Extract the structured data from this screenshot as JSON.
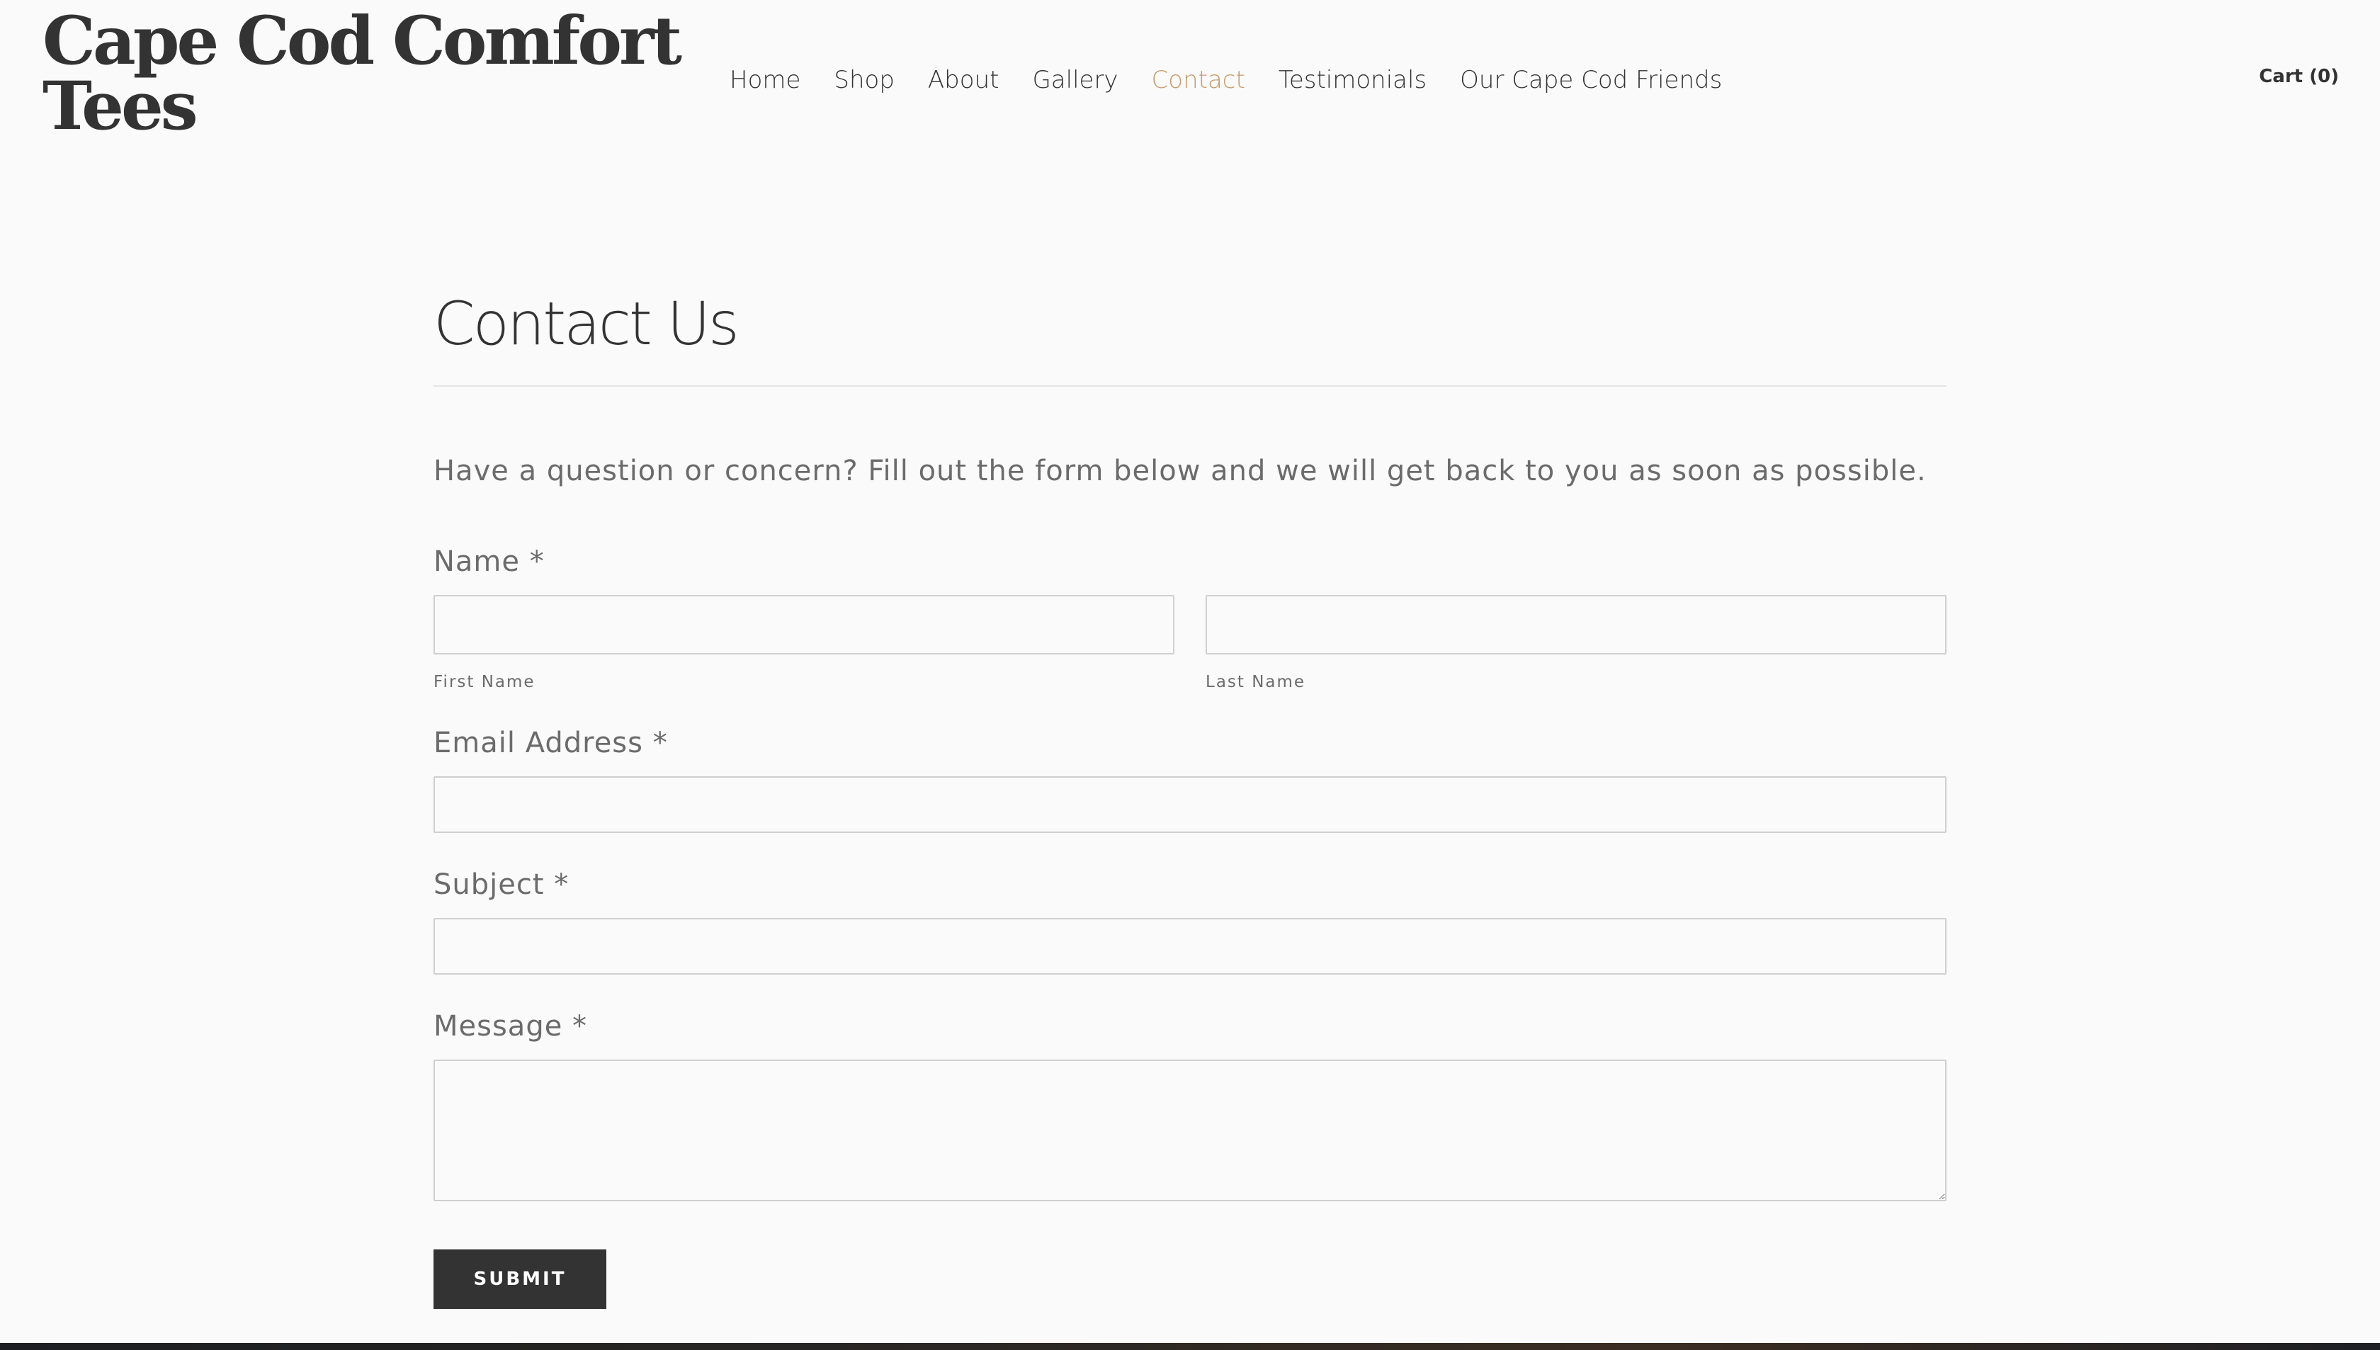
{
  "header": {
    "site_title": "Cape Cod Comfort Tees",
    "nav": [
      {
        "label": "Home",
        "active": false
      },
      {
        "label": "Shop",
        "active": false
      },
      {
        "label": "About",
        "active": false
      },
      {
        "label": "Gallery",
        "active": false
      },
      {
        "label": "Contact",
        "active": true
      },
      {
        "label": "Testimonials",
        "active": false
      },
      {
        "label": "Our Cape Cod Friends",
        "active": false
      }
    ],
    "cart_label": "Cart (0)"
  },
  "main": {
    "heading": "Contact Us",
    "intro": "Have a question or concern? Fill out the form below and we will get back to you as soon as possible.",
    "form": {
      "name_label": "Name *",
      "first_name_sublabel": "First Name",
      "first_name_value": "",
      "last_name_sublabel": "Last Name",
      "last_name_value": "",
      "email_label": "Email Address *",
      "email_value": "",
      "subject_label": "Subject *",
      "subject_value": "",
      "message_label": "Message *",
      "message_value": "",
      "submit_label": "SUBMIT"
    }
  },
  "colors": {
    "background": "#fafafa",
    "text": "#333333",
    "muted_text": "#6b6b6b",
    "accent_active_nav": "#c89a6a",
    "button_bg": "#333333"
  }
}
